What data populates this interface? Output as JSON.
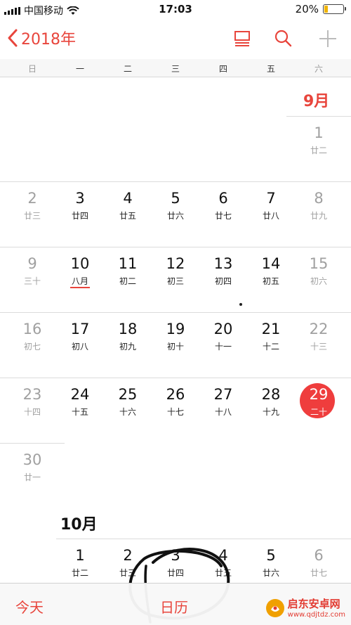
{
  "status_bar": {
    "carrier": "中国移动",
    "time": "17:03",
    "battery_percent_text": "20%",
    "battery_level": 0.2
  },
  "nav": {
    "back_label": "2018年",
    "icons": [
      "list-icon",
      "search-icon",
      "add-icon"
    ]
  },
  "weekdays": [
    "日",
    "一",
    "二",
    "三",
    "四",
    "五",
    "六"
  ],
  "colors": {
    "accent": "#e8453c",
    "today_circle": "#ef3d3d",
    "weekend_text": "#a0a0a0"
  },
  "september": {
    "label": "9月",
    "rows": [
      [
        [
          "1",
          "廿二"
        ]
      ],
      [
        [
          "2",
          "廿三"
        ],
        [
          "3",
          "廿四"
        ],
        [
          "4",
          "廿五"
        ],
        [
          "5",
          "廿六"
        ],
        [
          "6",
          "廿七"
        ],
        [
          "7",
          "廿八"
        ],
        [
          "8",
          "廿九"
        ]
      ],
      [
        [
          "9",
          "三十"
        ],
        [
          "10",
          "八月"
        ],
        [
          "11",
          "初二"
        ],
        [
          "12",
          "初三"
        ],
        [
          "13",
          "初四"
        ],
        [
          "14",
          "初五"
        ],
        [
          "15",
          "初六"
        ]
      ],
      [
        [
          "16",
          "初七"
        ],
        [
          "17",
          "初八"
        ],
        [
          "18",
          "初九"
        ],
        [
          "19",
          "初十"
        ],
        [
          "20",
          "十一"
        ],
        [
          "21",
          "十二"
        ],
        [
          "22",
          "十三"
        ]
      ],
      [
        [
          "23",
          "十四"
        ],
        [
          "24",
          "十五"
        ],
        [
          "25",
          "十六"
        ],
        [
          "26",
          "十七"
        ],
        [
          "27",
          "十八"
        ],
        [
          "28",
          "十九"
        ],
        [
          "29",
          "二十"
        ]
      ],
      [
        [
          "30",
          "廿一"
        ]
      ]
    ],
    "today": "29",
    "month_start_marker": "10"
  },
  "october": {
    "label": "10月",
    "rows": [
      [
        [
          "1",
          "廿二"
        ],
        [
          "2",
          "廿三"
        ],
        [
          "3",
          "廿四"
        ],
        [
          "4",
          "廿五"
        ],
        [
          "5",
          "廿六"
        ],
        [
          "6",
          "廿七"
        ]
      ]
    ]
  },
  "tab_bar": {
    "today_label": "今天",
    "calendar_label": "日历"
  },
  "watermark": {
    "title": "启东安卓网",
    "url": "www.qdjtdz.com"
  }
}
